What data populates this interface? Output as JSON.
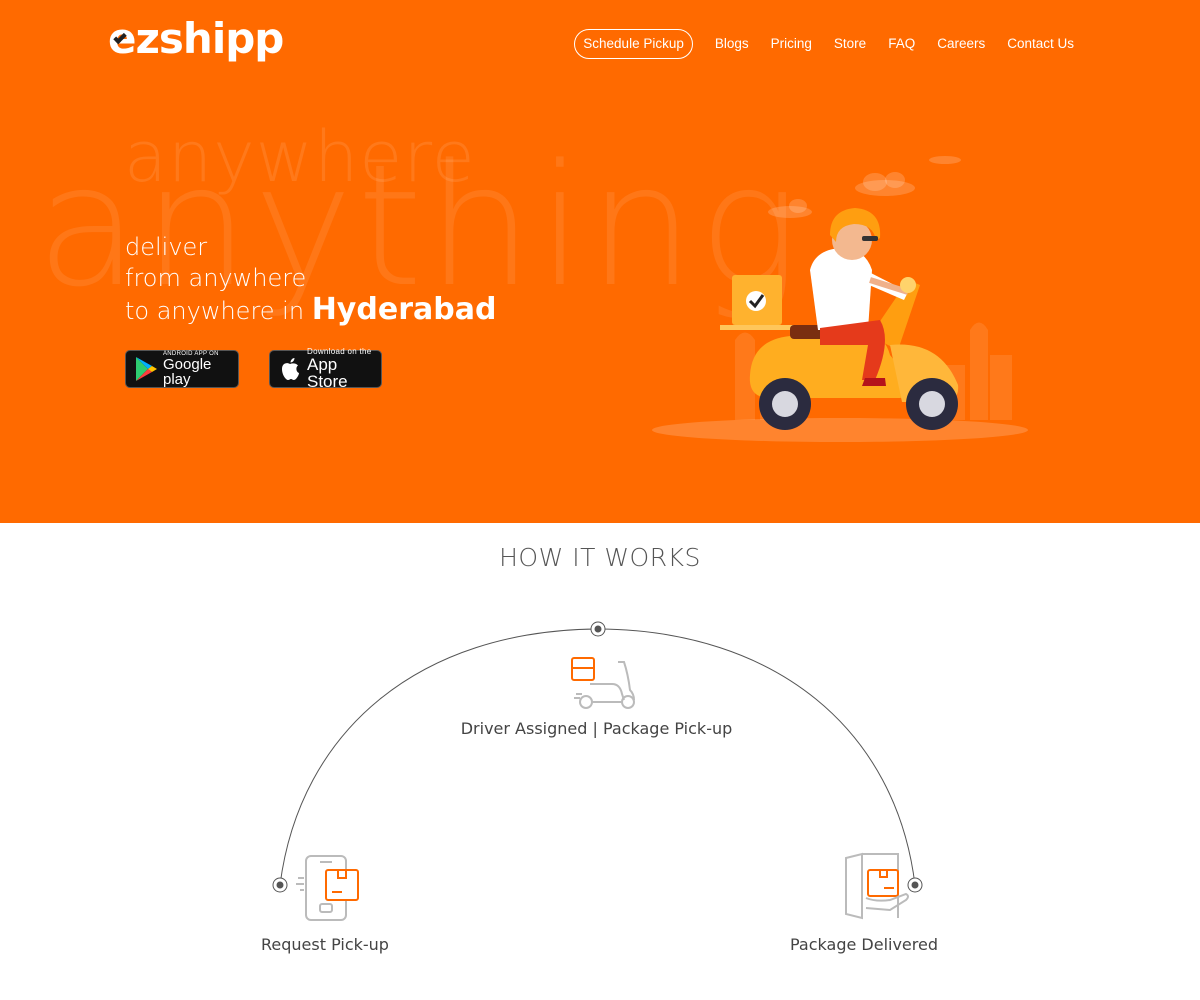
{
  "brand": {
    "logo_text": "ezshipp"
  },
  "nav": {
    "schedule_pickup": "Schedule Pickup",
    "blogs": "Blogs",
    "pricing": "Pricing",
    "store": "Store",
    "faq": "FAQ",
    "careers": "Careers",
    "contact": "Contact Us"
  },
  "hero": {
    "bg_word_small": "anywhere",
    "bg_word_large": "anything",
    "line1": "deliver",
    "line2": "from anywhere",
    "line3_prefix": "to anywhere in ",
    "city": "Hyderabad",
    "google_play": {
      "small": "ANDROID APP ON",
      "big": "Google play"
    },
    "app_store": {
      "small": "Download on the",
      "big": "App Store"
    }
  },
  "how_it_works": {
    "title": "HOW IT WORKS",
    "steps": [
      {
        "label": "Request Pick-up",
        "icon": "phone-package-icon"
      },
      {
        "label": "Driver Assigned  |  Package Pick-up",
        "icon": "scooter-package-icon"
      },
      {
        "label": "Package Delivered",
        "icon": "door-package-icon"
      }
    ]
  },
  "colors": {
    "brand_orange": "#ff6a00",
    "text_gray": "#444444"
  }
}
